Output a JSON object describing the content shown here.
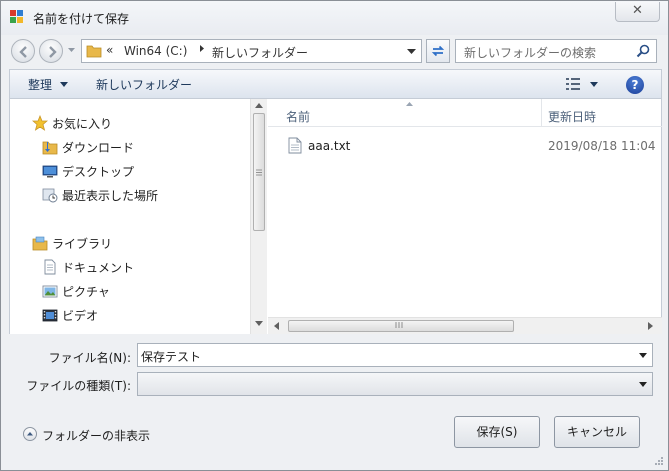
{
  "window": {
    "title": "名前を付けて保存",
    "close_label": "✕"
  },
  "address": {
    "chevron": "«",
    "crumbs": [
      "Win64 (C:)",
      "新しいフォルダー"
    ],
    "search_placeholder": "新しいフォルダーの検索"
  },
  "commandbar": {
    "organize": "整理",
    "new_folder": "新しいフォルダー",
    "help": "?"
  },
  "nav": {
    "items": [
      {
        "label": "お気に入り",
        "icon": "star-icon"
      },
      {
        "label": "ダウンロード",
        "icon": "downloads-icon"
      },
      {
        "label": "デスクトップ",
        "icon": "desktop-icon"
      },
      {
        "label": "最近表示した場所",
        "icon": "recent-places-icon"
      },
      {
        "label": "ライブラリ",
        "icon": "library-icon"
      },
      {
        "label": "ドキュメント",
        "icon": "documents-icon"
      },
      {
        "label": "ピクチャ",
        "icon": "pictures-icon"
      },
      {
        "label": "ビデオ",
        "icon": "videos-icon"
      }
    ]
  },
  "files": {
    "columns": {
      "name": "名前",
      "date": "更新日時"
    },
    "rows": [
      {
        "name": "aaa.txt",
        "date": "2019/08/18 11:04"
      }
    ]
  },
  "form": {
    "filename_label": "ファイル名(N):",
    "filename_value": "保存テスト",
    "filetype_label": "ファイルの種類(T):",
    "filetype_value": ""
  },
  "buttons": {
    "save": "保存(S)",
    "cancel": "キャンセル",
    "hide_folders": "フォルダーの非表示"
  },
  "colors": {
    "accent": "#1e395b",
    "help": "#1c3f99",
    "folder": "#e8b84a"
  }
}
